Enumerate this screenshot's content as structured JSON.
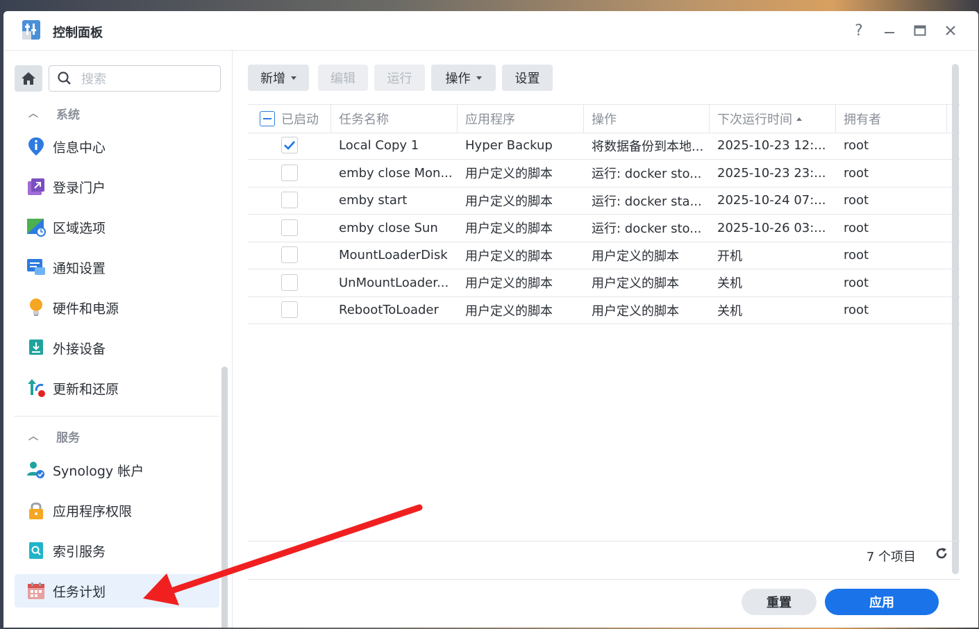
{
  "window": {
    "title": "控制面板",
    "controls": [
      "help-icon",
      "minimize-icon",
      "maximize-icon",
      "close-icon"
    ],
    "help_label": "?"
  },
  "sidebar": {
    "search_placeholder": "搜索",
    "sections": [
      {
        "label": "系统",
        "items": [
          {
            "label": "信息中心",
            "icon": "info-icon"
          },
          {
            "label": "登录门户",
            "icon": "login-portal-icon"
          },
          {
            "label": "区域选项",
            "icon": "regional-options-icon"
          },
          {
            "label": "通知设置",
            "icon": "notification-icon"
          },
          {
            "label": "硬件和电源",
            "icon": "hardware-power-icon"
          },
          {
            "label": "外接设备",
            "icon": "external-devices-icon"
          },
          {
            "label": "更新和还原",
            "icon": "update-restore-icon"
          }
        ]
      },
      {
        "label": "服务",
        "items": [
          {
            "label": "Synology 帐户",
            "icon": "synology-account-icon"
          },
          {
            "label": "应用程序权限",
            "icon": "app-privileges-icon"
          },
          {
            "label": "索引服务",
            "icon": "indexing-service-icon"
          },
          {
            "label": "任务计划",
            "icon": "task-scheduler-icon",
            "active": true
          }
        ]
      }
    ]
  },
  "toolbar": {
    "create": "新增",
    "edit": "编辑",
    "run": "运行",
    "action": "操作",
    "settings": "设置"
  },
  "table": {
    "columns": [
      "已启动",
      "任务名称",
      "应用程序",
      "操作",
      "下次运行时间",
      "拥有者"
    ],
    "sort_column": "下次运行时间",
    "sort_direction": "ascending",
    "rows": [
      {
        "enabled": true,
        "name": "Local Copy 1",
        "app": "Hyper Backup",
        "action": "将数据备份到本地...",
        "next_run": "2025-10-23 12:...",
        "owner": "root"
      },
      {
        "enabled": false,
        "name": "emby close Mon...",
        "app": "用户定义的脚本",
        "action": "运行: docker sto...",
        "next_run": "2025-10-23 23:...",
        "owner": "root"
      },
      {
        "enabled": false,
        "name": "emby start",
        "app": "用户定义的脚本",
        "action": "运行: docker sta...",
        "next_run": "2025-10-24 07:...",
        "owner": "root"
      },
      {
        "enabled": false,
        "name": "emby close Sun",
        "app": "用户定义的脚本",
        "action": "运行: docker sto...",
        "next_run": "2025-10-26 03:...",
        "owner": "root"
      },
      {
        "enabled": false,
        "name": "MountLoaderDisk",
        "app": "用户定义的脚本",
        "action": "用户定义的脚本",
        "next_run": "开机",
        "owner": "root"
      },
      {
        "enabled": false,
        "name": "UnMountLoader...",
        "app": "用户定义的脚本",
        "action": "用户定义的脚本",
        "next_run": "关机",
        "owner": "root"
      },
      {
        "enabled": false,
        "name": "RebootToLoader",
        "app": "用户定义的脚本",
        "action": "用户定义的脚本",
        "next_run": "关机",
        "owner": "root"
      }
    ]
  },
  "footer": {
    "count": "7 个项目",
    "reset": "重置",
    "apply": "应用"
  },
  "colors": {
    "accent": "#1a73e8",
    "active_bg": "#e8f1fc",
    "annotation_arrow": "#f02020"
  }
}
